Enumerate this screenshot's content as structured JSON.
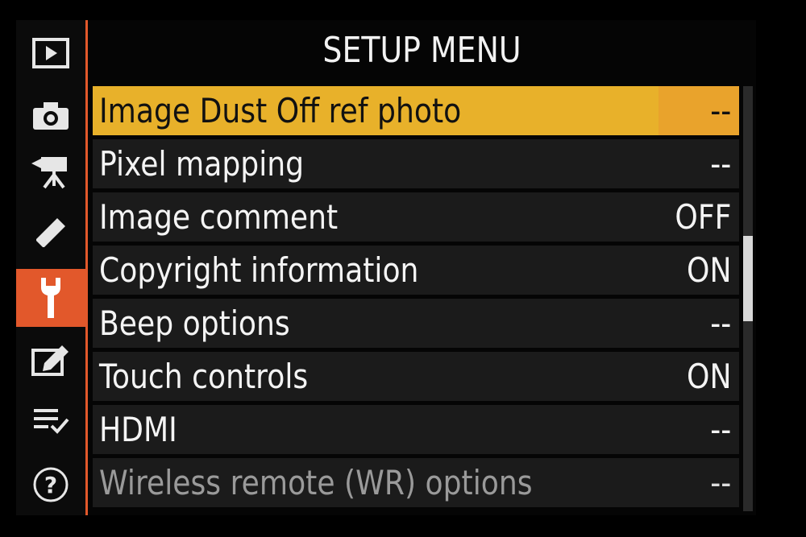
{
  "header": {
    "title": "SETUP MENU"
  },
  "sidebar": {
    "items": [
      {
        "icon": "playback-icon",
        "active": false
      },
      {
        "icon": "camera-icon",
        "active": false
      },
      {
        "icon": "movie-camera-icon",
        "active": false
      },
      {
        "icon": "pencil-icon",
        "active": false
      },
      {
        "icon": "wrench-icon",
        "active": true
      },
      {
        "icon": "retouch-icon",
        "active": false
      },
      {
        "icon": "my-menu-icon",
        "active": false
      },
      {
        "icon": "help-icon",
        "active": false
      }
    ]
  },
  "menu": {
    "items": [
      {
        "label": "Image Dust Off ref photo",
        "value": "--",
        "selected": true
      },
      {
        "label": "Pixel mapping",
        "value": "--"
      },
      {
        "label": "Image comment",
        "value": "OFF"
      },
      {
        "label": "Copyright information",
        "value": "ON"
      },
      {
        "label": "Beep options",
        "value": "--"
      },
      {
        "label": "Touch controls",
        "value": "ON"
      },
      {
        "label": "HDMI",
        "value": "--"
      },
      {
        "label": "Wireless remote (WR) options",
        "value": "--",
        "dimmed": true
      }
    ]
  },
  "scrollbar": {
    "position_fraction": 0.44,
    "visible_fraction": 0.2
  },
  "colors": {
    "accent": "#e2582b",
    "highlight": "#e8b12a",
    "row_background": "#1b1b1b"
  }
}
